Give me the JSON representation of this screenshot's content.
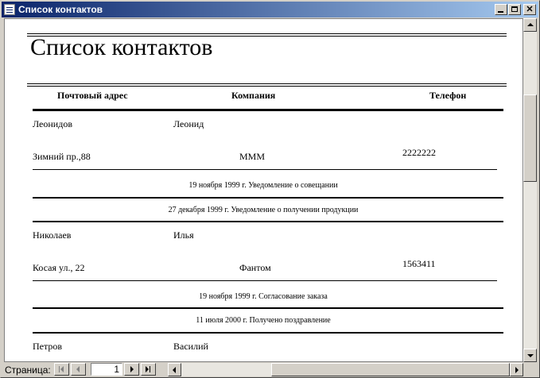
{
  "window": {
    "title": "Список контактов",
    "minimize_glyph": "",
    "maximize_glyph": "",
    "close_glyph": "✕"
  },
  "report": {
    "title": "Список контактов",
    "columns": {
      "address": "Почтовый адрес",
      "company": "Компания",
      "phone": "Телефон"
    },
    "records": [
      {
        "last_name": "Леонидов",
        "first_name": "Леонид",
        "address": "Зимний пр.,88",
        "company": "МММ",
        "phone": "2222222",
        "notes": [
          "19 ноября 1999 г.  Уведомление о совещании",
          "27 декабря 1999 г.  Уведомление о получении продукции"
        ]
      },
      {
        "last_name": "Николаев",
        "first_name": "Илья",
        "address": "Косая ул., 22",
        "company": "Фантом",
        "phone": "1563411",
        "notes": [
          "19 ноября 1999 г.  Согласование заказа",
          "11 июля 2000 г.  Получено поздравление"
        ]
      },
      {
        "last_name": "Петров",
        "first_name": "Василий"
      }
    ]
  },
  "navigation": {
    "page_label": "Страница:",
    "current_page": "1"
  },
  "icons": {
    "app": "report-icon",
    "first": "first-page-icon",
    "prev": "previous-page-icon",
    "next": "next-page-icon",
    "last": "last-page-icon"
  }
}
